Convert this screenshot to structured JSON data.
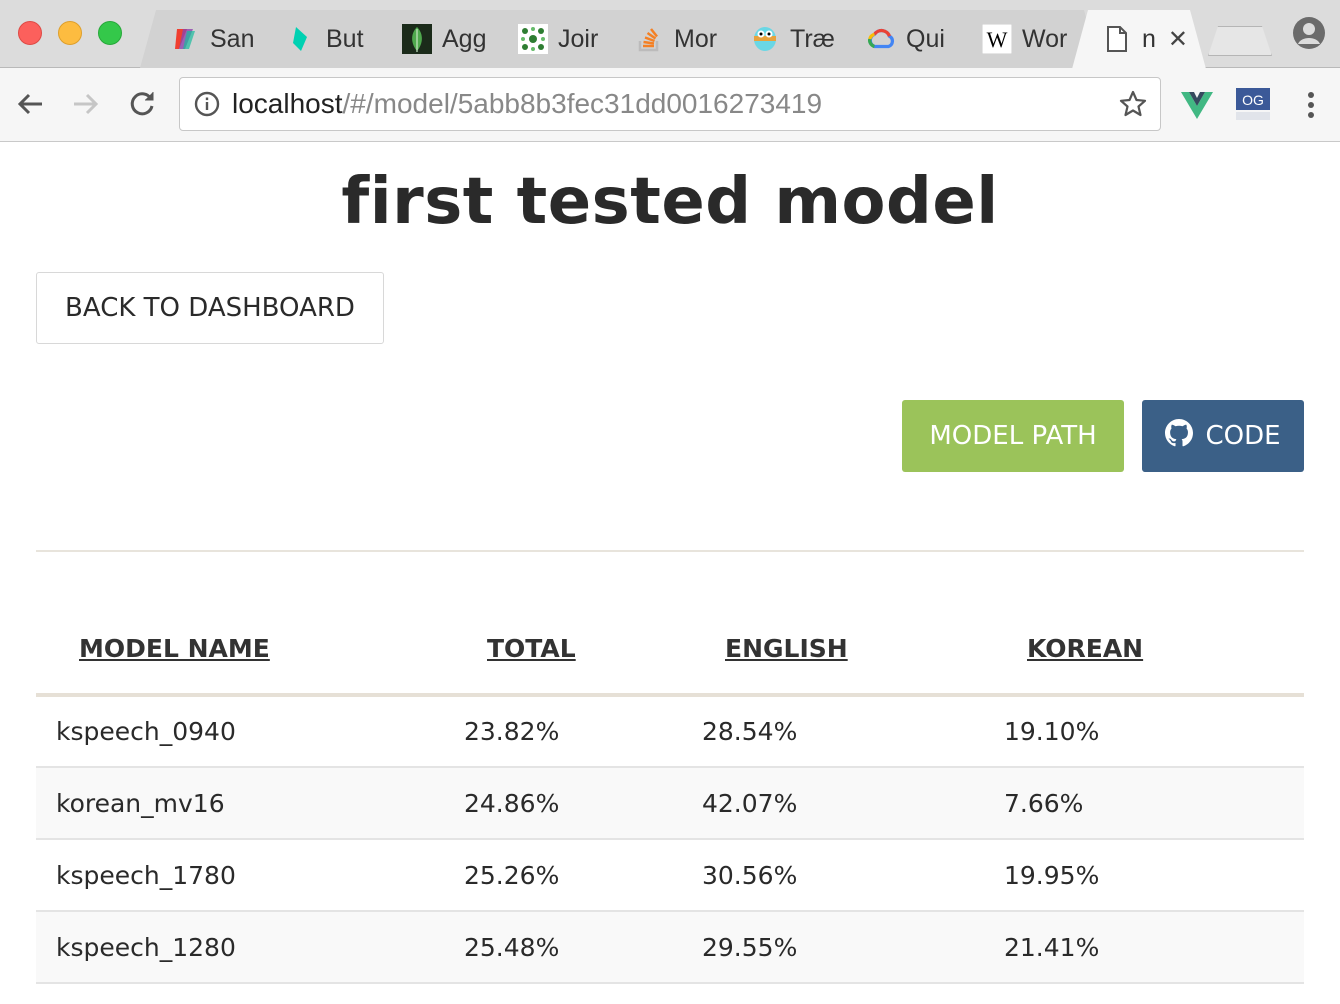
{
  "browser": {
    "tabs": [
      {
        "title": "San",
        "icon": "sanity-icon"
      },
      {
        "title": "But",
        "icon": "bulma-icon"
      },
      {
        "title": "Agg",
        "icon": "mongodb-leaf-icon"
      },
      {
        "title": "Joir",
        "icon": "green-dots-icon"
      },
      {
        "title": "Mor",
        "icon": "stackoverflow-icon"
      },
      {
        "title": "Træ",
        "icon": "gopher-icon"
      },
      {
        "title": "Qui",
        "icon": "google-cloud-icon"
      },
      {
        "title": "Wor",
        "icon": "wikipedia-icon"
      },
      {
        "title": "n",
        "icon": "page-icon"
      }
    ],
    "url_host": "localhost",
    "url_path": "/#/model/5abb8b3fec31dd0016273419",
    "extension_badge": "OG",
    "colors": {
      "vue": "#41b883",
      "og": "#3b5998"
    }
  },
  "page": {
    "title": "first tested model",
    "back_label": "BACK TO DASHBOARD",
    "model_path_label": "MODEL PATH",
    "code_label": "CODE",
    "colors": {
      "model_path": "#9bc35a",
      "code": "#3b6087"
    }
  },
  "table": {
    "headers": [
      "MODEL NAME",
      "TOTAL",
      "ENGLISH",
      "KOREAN"
    ],
    "rows": [
      [
        "kspeech_0940",
        "23.82%",
        "28.54%",
        "19.10%"
      ],
      [
        "korean_mv16",
        "24.86%",
        "42.07%",
        "7.66%"
      ],
      [
        "kspeech_1780",
        "25.26%",
        "30.56%",
        "19.95%"
      ],
      [
        "kspeech_1280",
        "25.48%",
        "29.55%",
        "21.41%"
      ]
    ]
  }
}
